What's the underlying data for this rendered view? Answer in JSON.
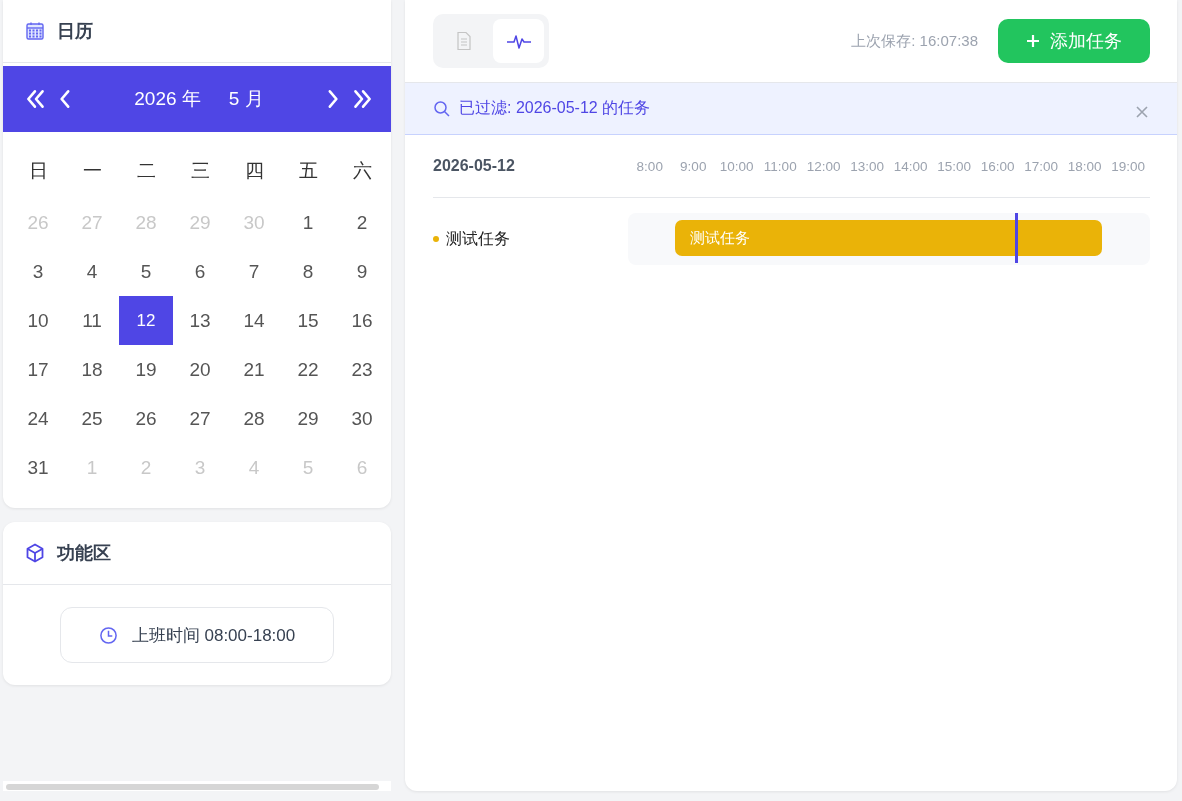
{
  "calendar": {
    "title": "日历",
    "year_label": "2026 年",
    "month_label": "5 月",
    "nav": [
      {
        "kind": "prev-year"
      },
      {
        "kind": "prev-month"
      },
      {
        "kind": "next-month"
      },
      {
        "kind": "next-year"
      }
    ],
    "weekdays": [
      "日",
      "一",
      "二",
      "三",
      "四",
      "五",
      "六"
    ],
    "weeks": [
      [
        {
          "day": "26",
          "muted": true,
          "selected": false
        },
        {
          "day": "27",
          "muted": true,
          "selected": false
        },
        {
          "day": "28",
          "muted": true,
          "selected": false
        },
        {
          "day": "29",
          "muted": true,
          "selected": false
        },
        {
          "day": "30",
          "muted": true,
          "selected": false
        },
        {
          "day": "1",
          "muted": false,
          "selected": false
        },
        {
          "day": "2",
          "muted": false,
          "selected": false
        }
      ],
      [
        {
          "day": "3",
          "muted": false,
          "selected": false
        },
        {
          "day": "4",
          "muted": false,
          "selected": false
        },
        {
          "day": "5",
          "muted": false,
          "selected": false
        },
        {
          "day": "6",
          "muted": false,
          "selected": false
        },
        {
          "day": "7",
          "muted": false,
          "selected": false
        },
        {
          "day": "8",
          "muted": false,
          "selected": false
        },
        {
          "day": "9",
          "muted": false,
          "selected": false
        }
      ],
      [
        {
          "day": "10",
          "muted": false,
          "selected": false
        },
        {
          "day": "11",
          "muted": false,
          "selected": false
        },
        {
          "day": "12",
          "muted": false,
          "selected": true
        },
        {
          "day": "13",
          "muted": false,
          "selected": false
        },
        {
          "day": "14",
          "muted": false,
          "selected": false
        },
        {
          "day": "15",
          "muted": false,
          "selected": false
        },
        {
          "day": "16",
          "muted": false,
          "selected": false
        }
      ],
      [
        {
          "day": "17",
          "muted": false,
          "selected": false
        },
        {
          "day": "18",
          "muted": false,
          "selected": false
        },
        {
          "day": "19",
          "muted": false,
          "selected": false
        },
        {
          "day": "20",
          "muted": false,
          "selected": false
        },
        {
          "day": "21",
          "muted": false,
          "selected": false
        },
        {
          "day": "22",
          "muted": false,
          "selected": false
        },
        {
          "day": "23",
          "muted": false,
          "selected": false
        }
      ],
      [
        {
          "day": "24",
          "muted": false,
          "selected": false
        },
        {
          "day": "25",
          "muted": false,
          "selected": false
        },
        {
          "day": "26",
          "muted": false,
          "selected": false
        },
        {
          "day": "27",
          "muted": false,
          "selected": false
        },
        {
          "day": "28",
          "muted": false,
          "selected": false
        },
        {
          "day": "29",
          "muted": false,
          "selected": false
        },
        {
          "day": "30",
          "muted": false,
          "selected": false
        }
      ],
      [
        {
          "day": "31",
          "muted": false,
          "selected": false
        },
        {
          "day": "1",
          "muted": true,
          "selected": false
        },
        {
          "day": "2",
          "muted": true,
          "selected": false
        },
        {
          "day": "3",
          "muted": true,
          "selected": false
        },
        {
          "day": "4",
          "muted": true,
          "selected": false
        },
        {
          "day": "5",
          "muted": true,
          "selected": false
        },
        {
          "day": "6",
          "muted": true,
          "selected": false
        }
      ]
    ]
  },
  "functions": {
    "title": "功能区",
    "work_hours_button": "上班时间 08:00-18:00"
  },
  "toolbar": {
    "views": [
      {
        "kind": "list",
        "selected": false
      },
      {
        "kind": "timeline",
        "selected": true
      }
    ],
    "last_saved": "上次保存: 16:07:38",
    "add_button": "添加任务"
  },
  "filter": {
    "text": "已过滤: 2026-05-12 的任务"
  },
  "timeline": {
    "date": "2026-05-12",
    "hours": [
      "8:00",
      "9:00",
      "10:00",
      "11:00",
      "12:00",
      "13:00",
      "14:00",
      "15:00",
      "16:00",
      "17:00",
      "18:00",
      "19:00"
    ],
    "now_marker": {
      "level": 0.741
    },
    "tasks": [
      {
        "name": "测试任务",
        "color": "#eab308",
        "bar": {
          "label": "测试任务"
        }
      }
    ]
  }
}
